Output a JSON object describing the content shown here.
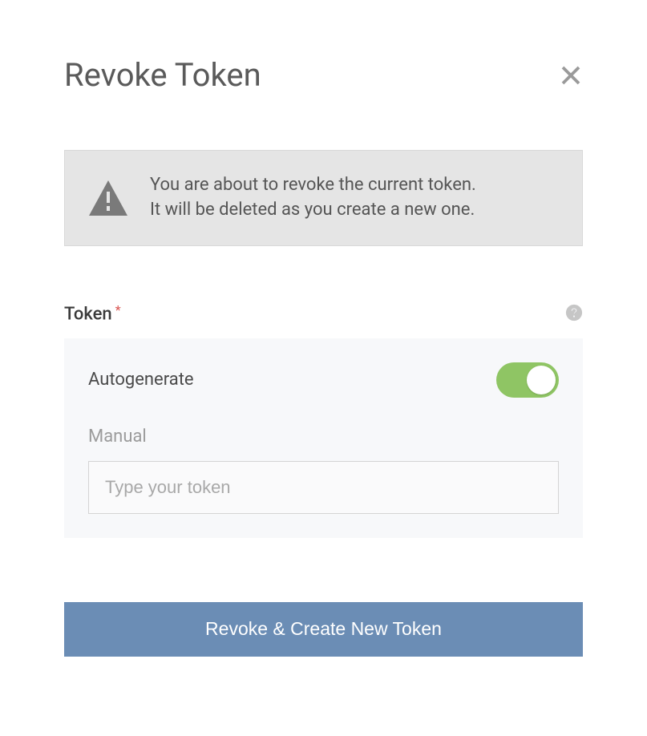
{
  "header": {
    "title": "Revoke Token"
  },
  "warning": {
    "line1": "You are about to revoke the current token.",
    "line2": "It will be deleted as you create a new one."
  },
  "token_section": {
    "label": "Token",
    "required_mark": "*",
    "autogenerate_label": "Autogenerate",
    "autogenerate_on": true,
    "manual_label": "Manual",
    "manual_placeholder": "Type your token",
    "manual_value": ""
  },
  "actions": {
    "primary_label": "Revoke & Create New Token"
  },
  "colors": {
    "toggle_on": "#8fc564",
    "primary_button": "#6b8db5",
    "warning_bg": "#e5e5e5",
    "panel_bg": "#f7f8fa"
  }
}
